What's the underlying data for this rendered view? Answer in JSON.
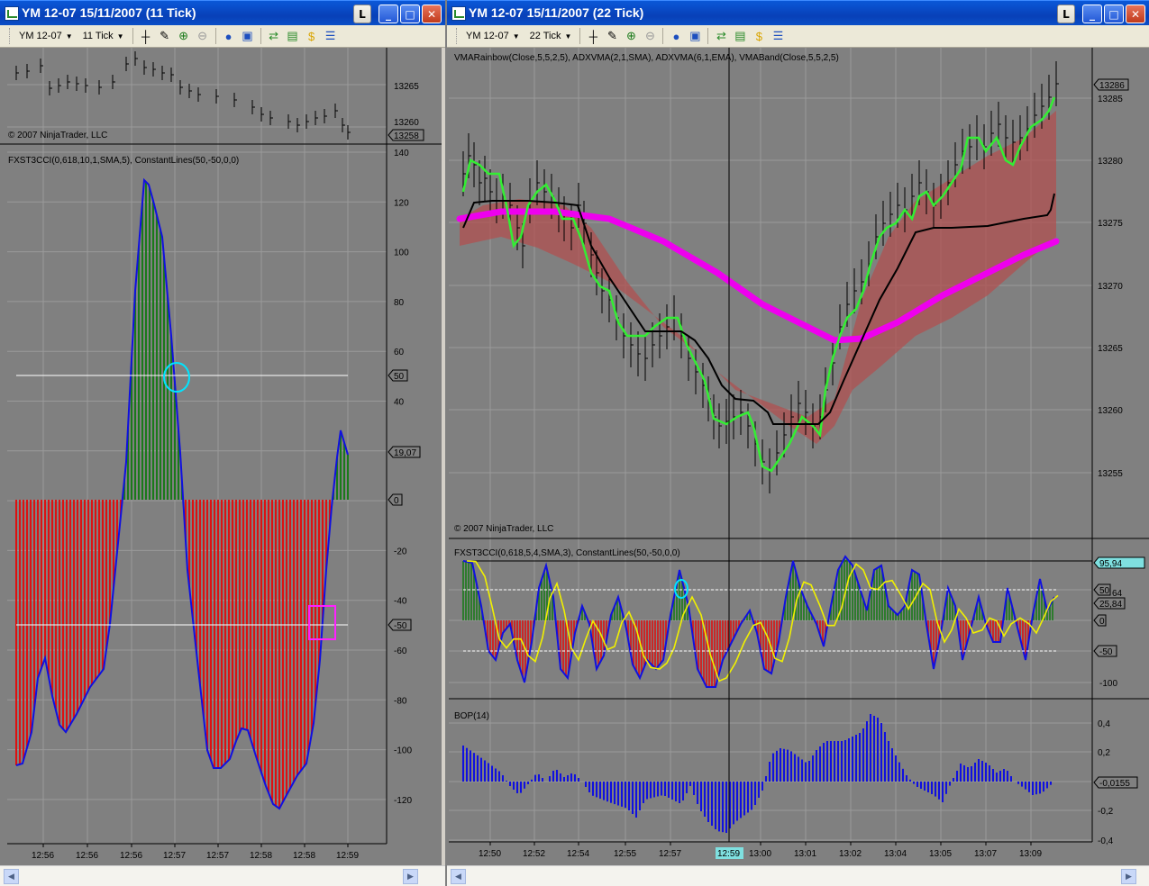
{
  "left": {
    "title": "YM 12-07  15/11/2007  (11 Tick)",
    "instrument": "YM 12-07",
    "interval": "11 Tick",
    "copyright": "© 2007 NinjaTrader, LLC",
    "cci_label": "FXST3CCI(0,618,10,1,SMA,5), ConstantLines(50,-50,0,0)",
    "price_ticks": [
      "13265",
      "13260"
    ],
    "price_last": "13258",
    "cci_ticks": [
      "140",
      "120",
      "100",
      "80",
      "60",
      "40",
      "20",
      "0",
      "-20",
      "-40",
      "-60",
      "-80",
      "-100",
      "-120"
    ],
    "cci_marker_50": "50",
    "cci_marker_m50": "-50",
    "cci_marker_0": "0",
    "cci_last": "19,07",
    "time_ticks": [
      "12:56",
      "12:56",
      "12:56",
      "12:57",
      "12:57",
      "12:58",
      "12:58",
      "12:59"
    ]
  },
  "right": {
    "title": "YM 12-07  15/11/2007  (22 Tick)",
    "instrument": "YM 12-07",
    "interval": "22 Tick",
    "copyright": "© 2007 NinjaTrader, LLC",
    "price_label": "VMARainbow(Close,5,5,2,5), ADXVMA(2,1,SMA), ADXVMA(6,1,EMA), VMABand(Close,5,5,2,5)",
    "cci_label": "FXST3CCI(0,618,5,4,SMA,3), ConstantLines(50,-50,0,0)",
    "bop_label": "BOP(14)",
    "price_ticks": [
      "13285",
      "13280",
      "13275",
      "13270",
      "13265",
      "13260",
      "13255"
    ],
    "price_last": "13286",
    "cci_ticks": [
      "-100"
    ],
    "cci_marker_top": "95,94",
    "cci_marker_50": "50",
    "cci_marker_64": "64",
    "cci_marker_2584": "25,84",
    "cci_marker_0": "0",
    "cci_marker_m50": "-50",
    "bop_ticks": [
      "0,4",
      "0,2",
      "-0,2",
      "-0,4"
    ],
    "bop_last": "-0,0155",
    "time_ticks": [
      "12:50",
      "12:52",
      "12:54",
      "12:55",
      "12:57",
      "13:00",
      "13:01",
      "13:02",
      "13:04",
      "13:05",
      "13:07",
      "13:09"
    ],
    "cursor_time": "12:59"
  },
  "buttons": {
    "lock": "L",
    "minimize": "_",
    "maximize": "□",
    "close": "✕"
  },
  "colors": {
    "chart_bg": "#808080",
    "cci_up": "#1a7a1a",
    "cci_down": "#dd1111",
    "cci_line": "#1010e0",
    "signal": "#f0f000",
    "rainbow": "#33ee33",
    "vma": "#000000",
    "band": "#ee00ee",
    "bop": "#1010e0"
  }
}
